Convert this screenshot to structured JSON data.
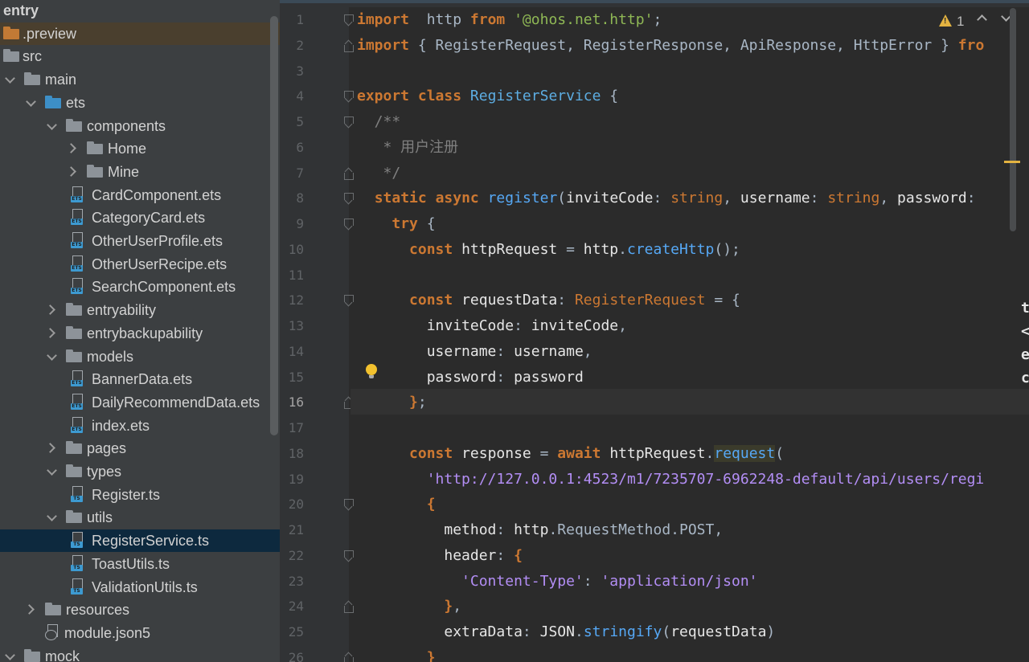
{
  "project_tree": {
    "items": [
      {
        "label": "entry",
        "depth": 0,
        "kind": "root",
        "arrow": "none",
        "bold": true
      },
      {
        "label": ".preview",
        "depth": 0,
        "kind": "folder-orange",
        "arrow": "none",
        "highlighted": true
      },
      {
        "label": "src",
        "depth": 0,
        "kind": "folder",
        "arrow": "none"
      },
      {
        "label": "main",
        "depth": 0,
        "kind": "folder",
        "arrow": "open"
      },
      {
        "label": "ets",
        "depth": 1,
        "kind": "folder-blue",
        "arrow": "open"
      },
      {
        "label": "components",
        "depth": 2,
        "kind": "folder",
        "arrow": "open"
      },
      {
        "label": "Home",
        "depth": 3,
        "kind": "folder",
        "arrow": "closed"
      },
      {
        "label": "Mine",
        "depth": 3,
        "kind": "folder",
        "arrow": "closed"
      },
      {
        "label": "CardComponent.ets",
        "depth": 3,
        "kind": "file-ets",
        "arrow": "none"
      },
      {
        "label": "CategoryCard.ets",
        "depth": 3,
        "kind": "file-ets",
        "arrow": "none"
      },
      {
        "label": "OtherUserProfile.ets",
        "depth": 3,
        "kind": "file-ets",
        "arrow": "none"
      },
      {
        "label": "OtherUserRecipe.ets",
        "depth": 3,
        "kind": "file-ets",
        "arrow": "none"
      },
      {
        "label": "SearchComponent.ets",
        "depth": 3,
        "kind": "file-ets",
        "arrow": "none"
      },
      {
        "label": "entryability",
        "depth": 2,
        "kind": "folder",
        "arrow": "closed"
      },
      {
        "label": "entrybackupability",
        "depth": 2,
        "kind": "folder",
        "arrow": "closed"
      },
      {
        "label": "models",
        "depth": 2,
        "kind": "folder",
        "arrow": "open"
      },
      {
        "label": "BannerData.ets",
        "depth": 3,
        "kind": "file-ets",
        "arrow": "none"
      },
      {
        "label": "DailyRecommendData.ets",
        "depth": 3,
        "kind": "file-ets",
        "arrow": "none"
      },
      {
        "label": "index.ets",
        "depth": 3,
        "kind": "file-ets",
        "arrow": "none"
      },
      {
        "label": "pages",
        "depth": 2,
        "kind": "folder",
        "arrow": "closed"
      },
      {
        "label": "types",
        "depth": 2,
        "kind": "folder",
        "arrow": "open"
      },
      {
        "label": "Register.ts",
        "depth": 3,
        "kind": "file-ts",
        "arrow": "none"
      },
      {
        "label": "utils",
        "depth": 2,
        "kind": "folder",
        "arrow": "open"
      },
      {
        "label": "RegisterService.ts",
        "depth": 3,
        "kind": "file-ts",
        "arrow": "none",
        "selected": true
      },
      {
        "label": "ToastUtils.ts",
        "depth": 3,
        "kind": "file-ts",
        "arrow": "none"
      },
      {
        "label": "ValidationUtils.ts",
        "depth": 3,
        "kind": "file-ts",
        "arrow": "none"
      },
      {
        "label": "resources",
        "depth": 1,
        "kind": "folder",
        "arrow": "closed"
      },
      {
        "label": "module.json5",
        "depth": 1,
        "kind": "file-json",
        "arrow": "none"
      },
      {
        "label": "mock",
        "depth": 0,
        "kind": "folder",
        "arrow": "open"
      }
    ],
    "badges": {
      "ets": "ETS",
      "ts": "TS"
    }
  },
  "editor": {
    "current_line": 16,
    "inspection": {
      "warning_count": "1",
      "warning_symbol": "!"
    },
    "right_peek": [
      "t",
      "<",
      "e",
      "c"
    ],
    "lines": [
      {
        "n": "1",
        "fold": "start",
        "tokens": [
          [
            "kw",
            "import"
          ],
          [
            "",
            "  http "
          ],
          [
            "kw",
            "from"
          ],
          [
            "",
            " "
          ],
          [
            "str",
            "'@ohos.net.http'"
          ],
          [
            "",
            ";"
          ]
        ]
      },
      {
        "n": "2",
        "fold": "end",
        "tokens": [
          [
            "kw",
            "import"
          ],
          [
            "",
            " { RegisterRequest, RegisterResponse, ApiResponse, HttpError } "
          ],
          [
            "kw",
            "fro"
          ]
        ]
      },
      {
        "n": "3",
        "fold": "",
        "tokens": []
      },
      {
        "n": "4",
        "fold": "start",
        "tokens": [
          [
            "kw",
            "export"
          ],
          [
            "",
            " "
          ],
          [
            "kw",
            "class"
          ],
          [
            "",
            " "
          ],
          [
            "cls",
            "RegisterService"
          ],
          [
            "",
            " {"
          ]
        ]
      },
      {
        "n": "5",
        "fold": "start",
        "tokens": [
          [
            "cm",
            "  /**"
          ]
        ]
      },
      {
        "n": "6",
        "fold": "",
        "tokens": [
          [
            "cm",
            "   * 用户注册"
          ]
        ]
      },
      {
        "n": "7",
        "fold": "end",
        "tokens": [
          [
            "cm",
            "   */"
          ]
        ]
      },
      {
        "n": "8",
        "fold": "start",
        "tokens": [
          [
            "",
            "  "
          ],
          [
            "kw",
            "static"
          ],
          [
            "",
            " "
          ],
          [
            "kw",
            "async"
          ],
          [
            "",
            " "
          ],
          [
            "fn",
            "register"
          ],
          [
            "",
            "("
          ],
          [
            "id",
            "inviteCode"
          ],
          [
            "",
            ": "
          ],
          [
            "typ",
            "string"
          ],
          [
            "",
            ", "
          ],
          [
            "id",
            "username"
          ],
          [
            "",
            ": "
          ],
          [
            "typ",
            "string"
          ],
          [
            "",
            ", "
          ],
          [
            "id",
            "password"
          ],
          [
            "",
            ":"
          ]
        ]
      },
      {
        "n": "9",
        "fold": "start",
        "tokens": [
          [
            "",
            "    "
          ],
          [
            "kw",
            "try"
          ],
          [
            "",
            " {"
          ]
        ]
      },
      {
        "n": "10",
        "fold": "",
        "tokens": [
          [
            "",
            "      "
          ],
          [
            "kw",
            "const"
          ],
          [
            "",
            " "
          ],
          [
            "id",
            "httpRequest"
          ],
          [
            "",
            " = "
          ],
          [
            "id",
            "http"
          ],
          [
            "",
            "."
          ],
          [
            "fn",
            "createHttp"
          ],
          [
            "",
            "();"
          ]
        ]
      },
      {
        "n": "11",
        "fold": "",
        "tokens": []
      },
      {
        "n": "12",
        "fold": "start",
        "tokens": [
          [
            "",
            "      "
          ],
          [
            "kw",
            "const"
          ],
          [
            "",
            " "
          ],
          [
            "id",
            "requestData"
          ],
          [
            "",
            ": "
          ],
          [
            "typ",
            "RegisterRequest"
          ],
          [
            "",
            " = {"
          ]
        ]
      },
      {
        "n": "13",
        "fold": "",
        "tokens": [
          [
            "",
            "        "
          ],
          [
            "id",
            "inviteCode"
          ],
          [
            "",
            ": "
          ],
          [
            "id",
            "inviteCode"
          ],
          [
            "",
            ","
          ]
        ]
      },
      {
        "n": "14",
        "fold": "",
        "tokens": [
          [
            "",
            "        "
          ],
          [
            "id",
            "username"
          ],
          [
            "",
            ": "
          ],
          [
            "id",
            "username"
          ],
          [
            "",
            ","
          ]
        ]
      },
      {
        "n": "15",
        "fold": "",
        "tokens": [
          [
            "",
            "        "
          ],
          [
            "id",
            "password"
          ],
          [
            "",
            ": "
          ],
          [
            "id",
            "password"
          ]
        ]
      },
      {
        "n": "16",
        "fold": "end",
        "tokens": [
          [
            "",
            "      "
          ],
          [
            "kw",
            "}"
          ],
          [
            "",
            ";"
          ]
        ]
      },
      {
        "n": "17",
        "fold": "",
        "tokens": []
      },
      {
        "n": "18",
        "fold": "",
        "tokens": [
          [
            "",
            "      "
          ],
          [
            "kw",
            "const"
          ],
          [
            "",
            " "
          ],
          [
            "id",
            "response"
          ],
          [
            "",
            " = "
          ],
          [
            "kw",
            "await"
          ],
          [
            "",
            " "
          ],
          [
            "id",
            "httpRequest"
          ],
          [
            "",
            "."
          ],
          [
            "fn hlw",
            "request"
          ],
          [
            "",
            "("
          ]
        ]
      },
      {
        "n": "19",
        "fold": "",
        "tokens": [
          [
            "",
            "        "
          ],
          [
            "str2",
            "'http://127.0.0.1:4523/m1/7235707-6962248-default/api/users/regi"
          ]
        ]
      },
      {
        "n": "20",
        "fold": "start",
        "tokens": [
          [
            "",
            "        "
          ],
          [
            "kw",
            "{"
          ]
        ]
      },
      {
        "n": "21",
        "fold": "",
        "tokens": [
          [
            "",
            "          "
          ],
          [
            "id",
            "method"
          ],
          [
            "",
            ": "
          ],
          [
            "id",
            "http"
          ],
          [
            "",
            ".RequestMethod.POST,"
          ]
        ]
      },
      {
        "n": "22",
        "fold": "start",
        "tokens": [
          [
            "",
            "          "
          ],
          [
            "id",
            "header"
          ],
          [
            "",
            ": "
          ],
          [
            "kw",
            "{"
          ]
        ]
      },
      {
        "n": "23",
        "fold": "",
        "tokens": [
          [
            "",
            "            "
          ],
          [
            "str2",
            "'Content-Type'"
          ],
          [
            "",
            ": "
          ],
          [
            "str2",
            "'application/json'"
          ]
        ]
      },
      {
        "n": "24",
        "fold": "end",
        "tokens": [
          [
            "",
            "          "
          ],
          [
            "kw",
            "}"
          ],
          [
            "",
            ","
          ]
        ]
      },
      {
        "n": "25",
        "fold": "",
        "tokens": [
          [
            "",
            "          "
          ],
          [
            "id",
            "extraData"
          ],
          [
            "",
            ": "
          ],
          [
            "id",
            "JSON"
          ],
          [
            "",
            "."
          ],
          [
            "fn",
            "stringify"
          ],
          [
            "",
            "("
          ],
          [
            "id",
            "requestData"
          ],
          [
            "",
            ")"
          ]
        ]
      },
      {
        "n": "26",
        "fold": "end",
        "tokens": [
          [
            "",
            "        "
          ],
          [
            "kw",
            "}"
          ]
        ]
      }
    ]
  }
}
